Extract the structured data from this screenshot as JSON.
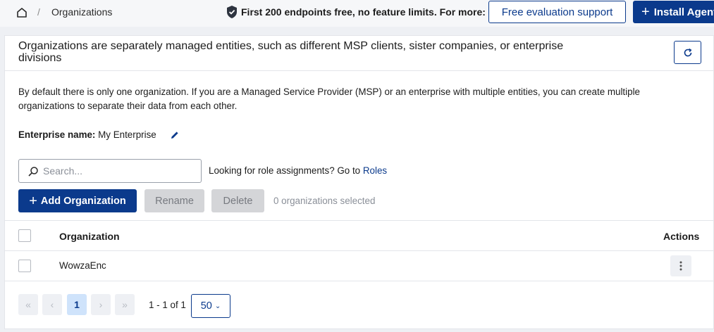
{
  "breadcrumb": {
    "separator": "/",
    "current": "Organizations"
  },
  "promo": {
    "text": "First 200 endpoints free, no feature limits. For more:",
    "evaluation_button": "Free evaluation support",
    "install_button": "Install Agent"
  },
  "page": {
    "title": "Organizations are separately managed entities, such as different MSP clients, sister companies, or enterprise divisions",
    "description": "By default there is only one organization. If you are a Managed Service Provider (MSP) or an enterprise with multiple entities, you can create multiple organizations to separate their data from each other.",
    "enterprise_label": "Enterprise name:",
    "enterprise_value": "My Enterprise"
  },
  "search": {
    "placeholder": "Search...",
    "value": ""
  },
  "roles_hint": {
    "prefix": "Looking for role assignments? Go to",
    "link": "Roles"
  },
  "toolbar": {
    "add_label": "Add Organization",
    "rename_label": "Rename",
    "delete_label": "Delete",
    "selection_status": "0 organizations selected"
  },
  "table": {
    "columns": [
      "Organization",
      "Actions"
    ],
    "rows": [
      {
        "organization": "WowzaEnc"
      }
    ]
  },
  "pagination": {
    "first": "«",
    "prev": "‹",
    "current_page": "1",
    "next": "›",
    "last": "»",
    "range": "1 - 1 of 1",
    "page_size": "50"
  },
  "colors": {
    "primary": "#0b3a8c",
    "background": "#eef0f4",
    "disabled_button": "#d4d5d8",
    "pager_current": "#cfe3fb"
  },
  "icons": [
    "home-icon",
    "shield-check-icon",
    "plus-icon",
    "refresh-icon",
    "pencil-icon",
    "search-icon",
    "kebab-menu-icon",
    "chevron-down-icon"
  ]
}
